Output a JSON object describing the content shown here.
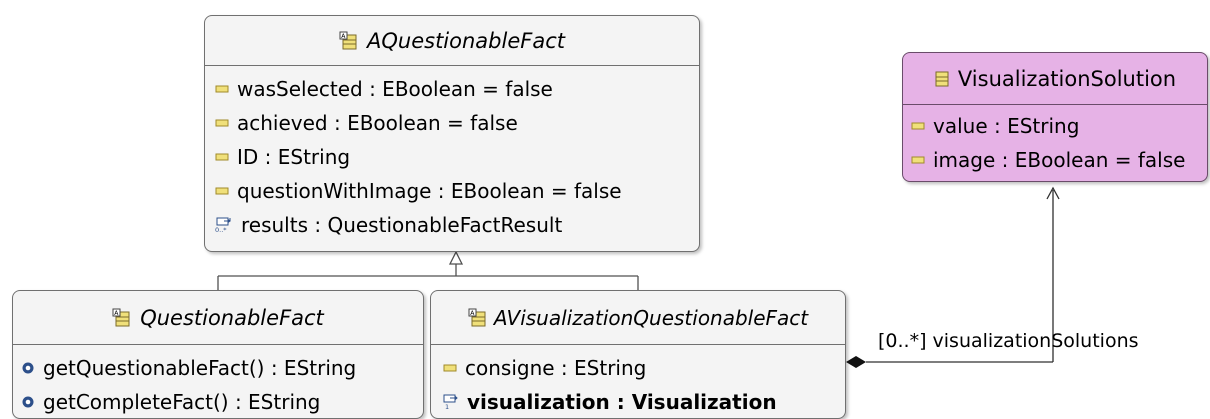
{
  "classes": {
    "aquestionablefact": {
      "title": "AQuestionableFact",
      "attributes": [
        "wasSelected : EBoolean = false",
        "achieved : EBoolean = false",
        "ID : EString",
        "questionWithImage : EBoolean = false"
      ],
      "reference": "results : QuestionableFactResult",
      "icons": [
        "abstract-class-icon",
        "attribute-icon",
        "multivalued-reference-icon"
      ]
    },
    "questionablefact": {
      "title": "QuestionableFact",
      "operations": [
        "getQuestionableFact() : EString",
        "getCompleteFact() : EString"
      ],
      "icons": [
        "abstract-class-icon",
        "operation-icon"
      ]
    },
    "avisualizationquestionablefact": {
      "title": "AVisualizationQuestionableFact",
      "attribute": "consigne : EString",
      "reference": "visualization : Visualization",
      "icons": [
        "abstract-class-icon",
        "attribute-icon",
        "single-reference-icon"
      ]
    },
    "visualizationsolution": {
      "title": "VisualizationSolution",
      "attributes": [
        "value : EString",
        "image : EBoolean = false"
      ],
      "icons": [
        "class-icon",
        "attribute-icon"
      ]
    }
  },
  "association": {
    "label": "[0..*] visualizationSolutions"
  },
  "colors": {
    "gray_fill": "#f4f4f4",
    "pink_fill": "#e6b2e6",
    "border": "#707070",
    "icon_yellow": "#f0e07a",
    "icon_border": "#a08a2a",
    "operation_blue": "#2c4f8a",
    "link_line": "#404040"
  }
}
